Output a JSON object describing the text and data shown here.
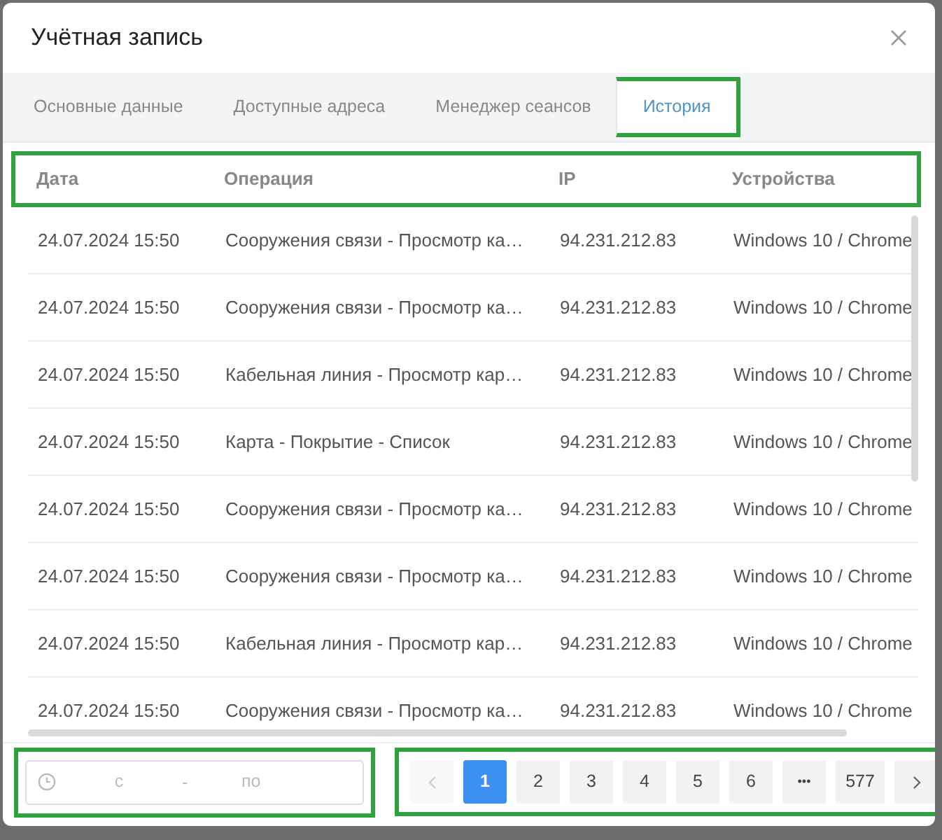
{
  "dialog": {
    "title": "Учётная запись"
  },
  "tabs": [
    {
      "label": "Основные данные",
      "selected": false
    },
    {
      "label": "Доступные адреса",
      "selected": false
    },
    {
      "label": "Менеджер сеансов",
      "selected": false
    },
    {
      "label": "История",
      "selected": true
    }
  ],
  "table": {
    "columns": [
      "Дата",
      "Операция",
      "IP",
      "Устройства"
    ],
    "rows": [
      [
        "24.07.2024 15:50",
        "Сооружения связи - Просмотр ка…",
        "94.231.212.83",
        "Windows 10 / Chrome"
      ],
      [
        "24.07.2024 15:50",
        "Сооружения связи - Просмотр ка…",
        "94.231.212.83",
        "Windows 10 / Chrome"
      ],
      [
        "24.07.2024 15:50",
        "Кабельная линия - Просмотр кар…",
        "94.231.212.83",
        "Windows 10 / Chrome"
      ],
      [
        "24.07.2024 15:50",
        "Карта - Покрытие - Список",
        "94.231.212.83",
        "Windows 10 / Chrome"
      ],
      [
        "24.07.2024 15:50",
        "Сооружения связи - Просмотр ка…",
        "94.231.212.83",
        "Windows 10 / Chrome"
      ],
      [
        "24.07.2024 15:50",
        "Сооружения связи - Просмотр ка…",
        "94.231.212.83",
        "Windows 10 / Chrome"
      ],
      [
        "24.07.2024 15:50",
        "Кабельная линия - Просмотр кар…",
        "94.231.212.83",
        "Windows 10 / Chrome"
      ],
      [
        "24.07.2024 15:50",
        "Сооружения связи - Просмотр ка…",
        "94.231.212.83",
        "Windows 10 / Chrome"
      ]
    ]
  },
  "date_range": {
    "from_placeholder": "с",
    "separator": "-",
    "to_placeholder": "по"
  },
  "pagination": [
    {
      "kind": "prev",
      "disabled": true
    },
    {
      "kind": "page",
      "label": "1",
      "selected": true
    },
    {
      "kind": "page",
      "label": "2",
      "selected": false
    },
    {
      "kind": "page",
      "label": "3",
      "selected": false
    },
    {
      "kind": "page",
      "label": "4",
      "selected": false
    },
    {
      "kind": "page",
      "label": "5",
      "selected": false
    },
    {
      "kind": "page",
      "label": "6",
      "selected": false
    },
    {
      "kind": "ellipsis",
      "label": "•••"
    },
    {
      "kind": "page",
      "label": "577",
      "selected": false
    },
    {
      "kind": "next",
      "disabled": false
    }
  ]
}
